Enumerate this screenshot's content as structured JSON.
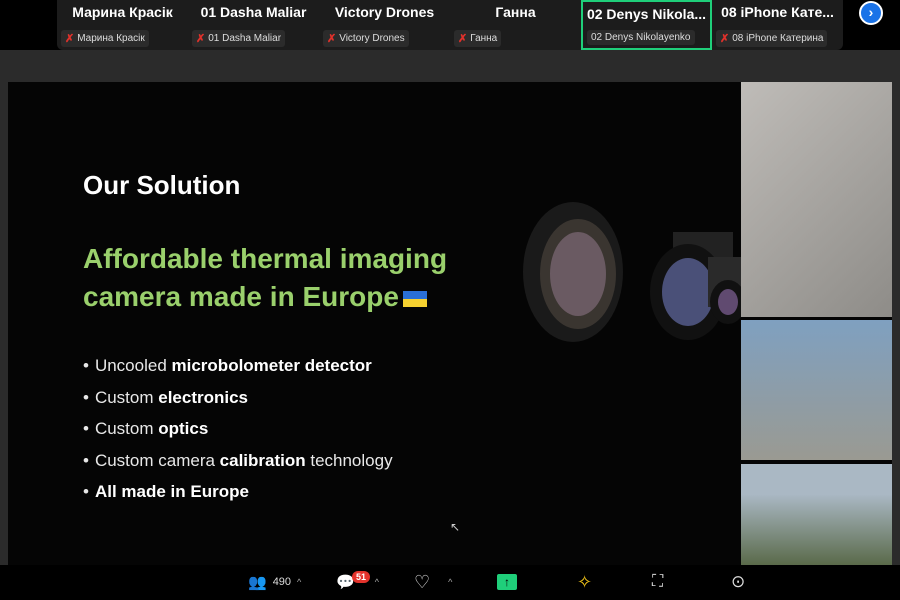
{
  "participants": [
    {
      "name": "Марина Красік",
      "label": "Марина Красік",
      "muted": true
    },
    {
      "name": "01 Dasha Maliar",
      "label": "01 Dasha Maliar",
      "muted": true
    },
    {
      "name": "Victory Drones",
      "label": "Victory Drones",
      "muted": true
    },
    {
      "name": "Ганна",
      "label": "Ганна",
      "muted": true
    },
    {
      "name": "02 Denys Nikola...",
      "label": "02 Denys Nikolayenko",
      "muted": false,
      "active": true
    },
    {
      "name": "08 iPhone Кате...",
      "label": "08 iPhone Катерина",
      "muted": true
    }
  ],
  "slide": {
    "title": "Our Solution",
    "subtitle_line1": "Affordable thermal imaging",
    "subtitle_line2": "camera made in Europe",
    "bullets": [
      {
        "pre": "Uncooled ",
        "bold": "microbolometer detector",
        "post": ""
      },
      {
        "pre": "Custom ",
        "bold": "electronics",
        "post": ""
      },
      {
        "pre": "Custom ",
        "bold": "optics",
        "post": ""
      },
      {
        "pre": "Custom camera ",
        "bold": "calibration",
        "post": " technology"
      },
      {
        "pre": "",
        "bold": "All made in Europe",
        "post": ""
      }
    ]
  },
  "toolbar": {
    "participants_count": "490",
    "chat_badge": "51"
  },
  "colors": {
    "accent_green": "#1fcf7a",
    "subtitle_green": "#9ad06c",
    "badge_red": "#e3332c"
  }
}
